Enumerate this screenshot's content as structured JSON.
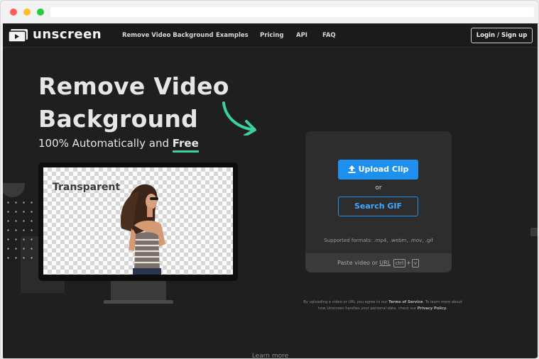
{
  "window": {
    "controls": [
      "close",
      "minimize",
      "maximize"
    ],
    "address": ""
  },
  "nav": {
    "logo_text": "unscreen",
    "logo_icon": "play-icon",
    "links": [
      "Remove Video Background",
      "Examples",
      "Pricing",
      "API",
      "FAQ"
    ],
    "login_label": "Login / Sign up"
  },
  "hero": {
    "headline_line1": "Remove Video",
    "headline_line2": "Background",
    "subline_prefix": "100% Automatically and ",
    "subline_free": "Free",
    "monitor_label": "Transparent"
  },
  "upload": {
    "upload_label": "Upload Clip",
    "or_text": "or",
    "search_label": "Search GIF",
    "formats": "Supported formats: .mp4, .webm, .mov, .gif",
    "paste_prefix": "Paste video or ",
    "paste_url": "URL",
    "key_ctrl": "ctrl",
    "key_plus": "+",
    "key_v": "v"
  },
  "legal": {
    "part1": "By uploading a video or URL you agree to our ",
    "terms": "Terms of Service",
    "part2": ". To learn more about how Unscreen handles your personal data, check our ",
    "privacy": "Privacy Policy",
    "part3": "."
  },
  "footer": {
    "learn_more": "Learn more"
  },
  "colors": {
    "accent": "#1e90f0",
    "highlight": "#3ecf9e",
    "background": "#1f1f1f"
  }
}
